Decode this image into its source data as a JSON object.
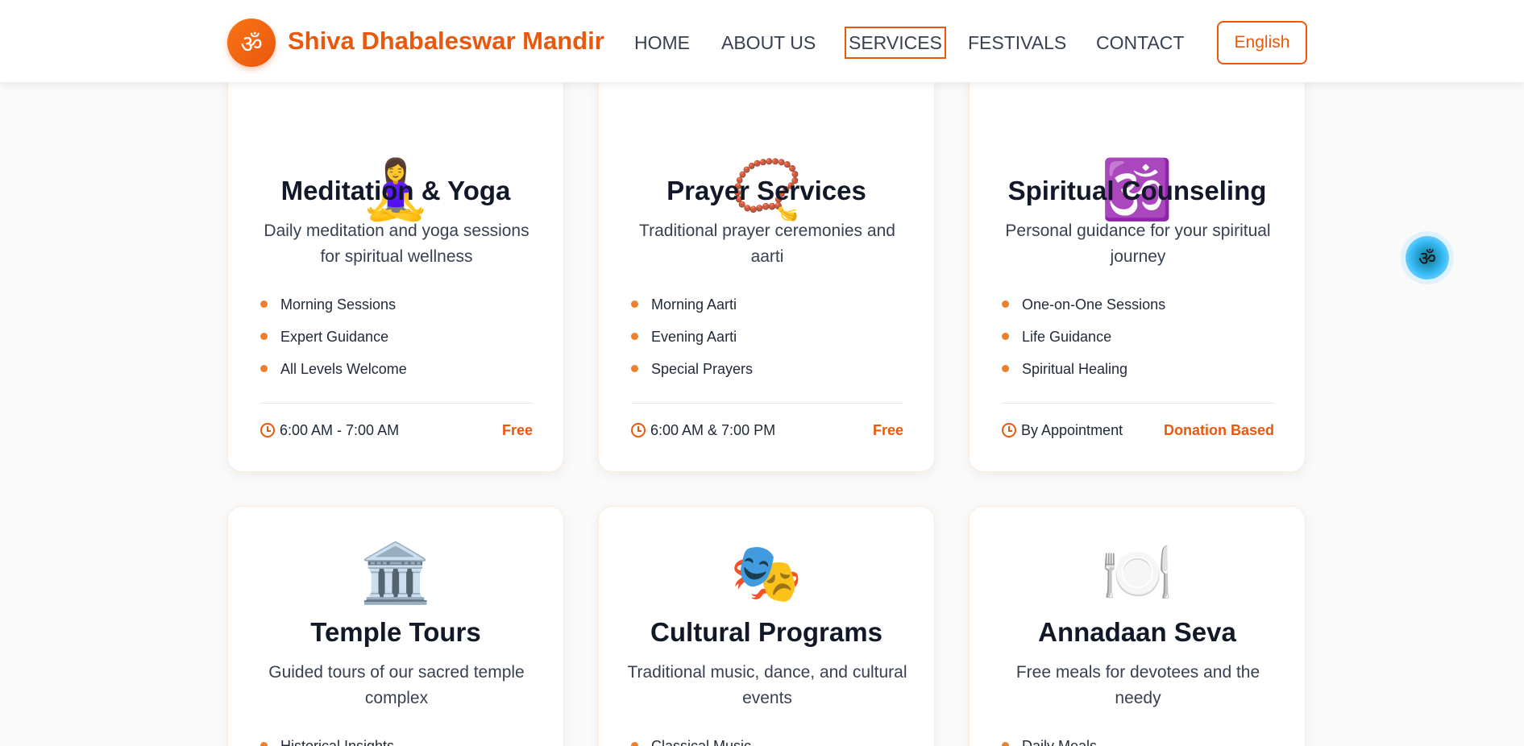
{
  "header": {
    "logo_glyph": "ॐ",
    "brand": "Shiva Dhabaleswar Mandir",
    "nav": [
      {
        "label": "HOME"
      },
      {
        "label": "ABOUT US"
      },
      {
        "label": "SERVICES"
      },
      {
        "label": "FESTIVALS"
      },
      {
        "label": "CONTACT"
      }
    ],
    "active_nav": "SERVICES",
    "language": "English"
  },
  "colors": {
    "accent": "#ea580c",
    "bullet": "#f07f2c",
    "title": "#111827"
  },
  "cards": [
    {
      "icon": "🧘‍♀️",
      "icon_name": "meditation-icon",
      "title": "Meditation & Yoga",
      "desc": "Daily meditation and yoga sessions for spiritual wellness",
      "features": [
        "Morning Sessions",
        "Expert Guidance",
        "All Levels Welcome"
      ],
      "time": "6:00 AM - 7:00 AM",
      "price": "Free"
    },
    {
      "icon": "📿",
      "icon_name": "prayer-beads-icon",
      "title": "Prayer Services",
      "desc": "Traditional prayer ceremonies and aarti",
      "features": [
        "Morning Aarti",
        "Evening Aarti",
        "Special Prayers"
      ],
      "time": "6:00 AM & 7:00 PM",
      "price": "Free"
    },
    {
      "icon": "🕉️",
      "icon_name": "om-icon",
      "title": "Spiritual Counseling",
      "desc": "Personal guidance for your spiritual journey",
      "features": [
        "One-on-One Sessions",
        "Life Guidance",
        "Spiritual Healing"
      ],
      "time": "By Appointment",
      "price": "Donation Based"
    },
    {
      "icon": "🏛️",
      "icon_name": "temple-icon",
      "title": "Temple Tours",
      "desc": "Guided tours of our sacred temple complex",
      "features": [
        "Historical Insights"
      ],
      "time": "",
      "price": ""
    },
    {
      "icon": "🎭",
      "icon_name": "theater-masks-icon",
      "title": "Cultural Programs",
      "desc": "Traditional music, dance, and cultural events",
      "features": [
        "Classical Music"
      ],
      "time": "",
      "price": ""
    },
    {
      "icon": "🍽️",
      "icon_name": "plate-cutlery-icon",
      "title": "Annadaan Seva",
      "desc": "Free meals for devotees and the needy",
      "features": [
        "Daily Meals"
      ],
      "time": "",
      "price": ""
    }
  ],
  "floating_button": {
    "glyph": "ॐ"
  }
}
